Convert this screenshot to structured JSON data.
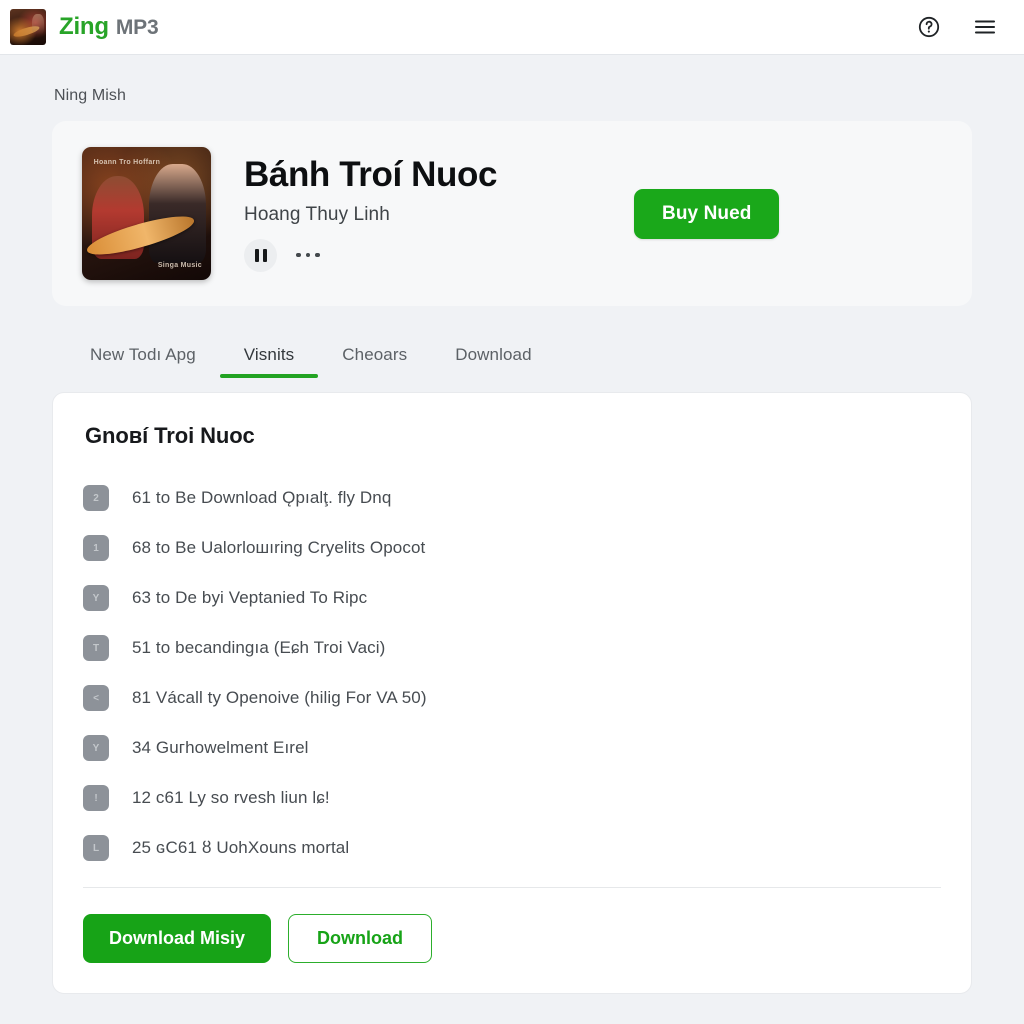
{
  "topbar": {
    "brand_primary": "Zing",
    "brand_secondary": "MP3",
    "help_icon": "help-circle-icon",
    "menu_icon": "hamburger-menu-icon",
    "accent_green": "#28a428"
  },
  "breadcrumb": "Ning Mish",
  "hero": {
    "cover_caption_top": "Hoann Tro Hoffarn",
    "cover_caption_bottom": "Singa Music",
    "title": "Bánh Troí Nuoc",
    "artist": "Hoang Thuy Linh",
    "play_icon": "pause-icon",
    "more_icon": "more-options-icon",
    "buy_label": "Buy Nued",
    "buy_color": "#1aa81a"
  },
  "tabs": [
    {
      "label": "New Todı Apg",
      "active": false
    },
    {
      "label": "Visnits",
      "active": true
    },
    {
      "label": "Cheoars",
      "active": false
    },
    {
      "label": "Download",
      "active": false
    }
  ],
  "panel": {
    "title": "Gnoʙí Troi Nuoc",
    "tracks": [
      {
        "badge": "2",
        "label": "61 to Be Download Ǫpıalţ. fly Dnq"
      },
      {
        "badge": "1",
        "label": "68 to Be Ualorloшıring Cryelits Opocot"
      },
      {
        "badge": "Y",
        "label": "63 to De byi Veptanied To Ripc"
      },
      {
        "badge": "T",
        "label": "51 to becandingıa (Eɕh Troi Vaci)"
      },
      {
        "badge": "<",
        "label": "81 Vácall ty Openoive (hilig For VA 50)"
      },
      {
        "badge": "Y",
        "label": "34 Guгhowelment  Eırel"
      },
      {
        "badge": "!",
        "label": "12 c61 Ly so rvesh liun lɕ!"
      },
      {
        "badge": "L",
        "label": "25 ɢС61 ȣ UohХouns mortal"
      }
    ],
    "primary_action": "Download Misiy",
    "secondary_action": "Download"
  }
}
